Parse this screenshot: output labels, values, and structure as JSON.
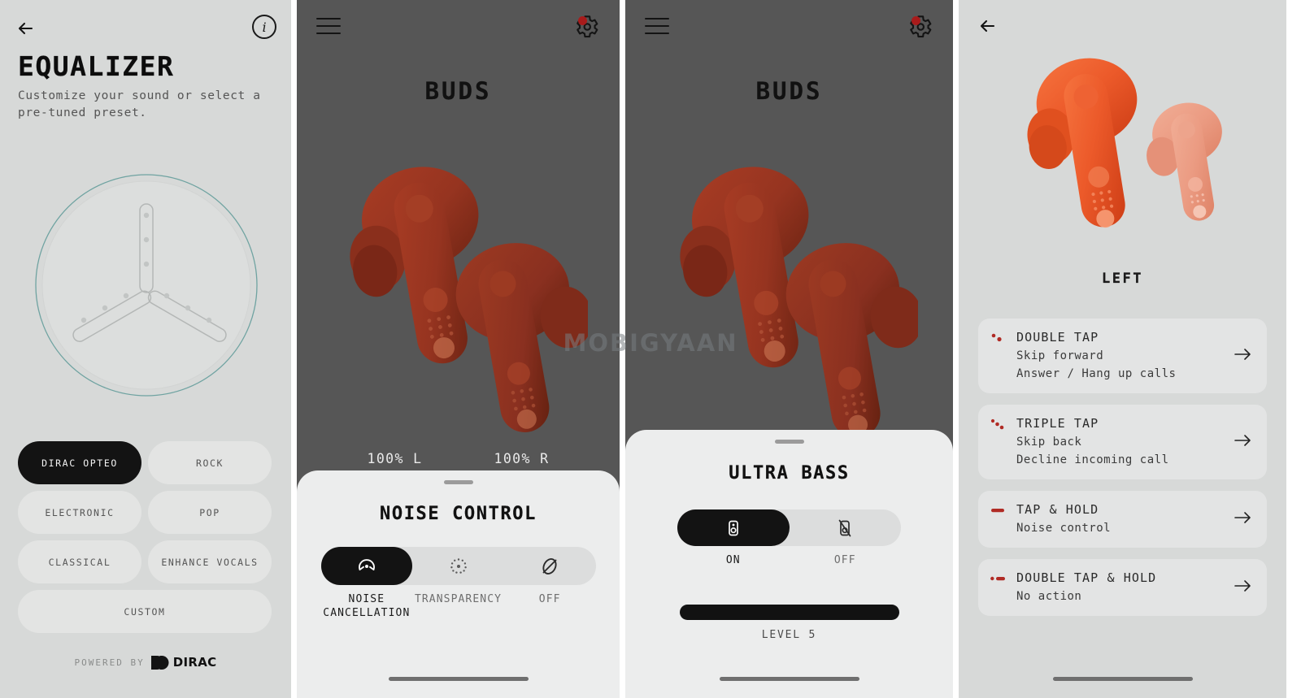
{
  "panel1": {
    "name": "equalizer-screen",
    "back_icon": "back-arrow-icon",
    "info_icon": "info-icon",
    "info_glyph": "i",
    "title": "EQUALIZER",
    "subtitle": "Customize your sound or select a pre-tuned preset.",
    "dial": {
      "name": "equalizer-dial",
      "arms": 3,
      "dots_per_arm": 3
    },
    "presets": [
      {
        "label": "DIRAC OPTEO",
        "active": true,
        "wide": false
      },
      {
        "label": "ROCK",
        "active": false,
        "wide": false
      },
      {
        "label": "ELECTRONIC",
        "active": false,
        "wide": false
      },
      {
        "label": "POP",
        "active": false,
        "wide": false
      },
      {
        "label": "CLASSICAL",
        "active": false,
        "wide": false
      },
      {
        "label": "ENHANCE VOCALS",
        "active": false,
        "wide": false
      },
      {
        "label": "CUSTOM",
        "active": false,
        "wide": true
      }
    ],
    "powered_by": "POWERED BY",
    "brand": "DIRAC"
  },
  "panel2": {
    "name": "buds-noise-control-screen",
    "menu_icon": "hamburger-menu-icon",
    "settings_icon": "gear-icon",
    "settings_badge": true,
    "title": "BUDS",
    "battery_left": "100% L",
    "battery_right": "100% R",
    "sheet_title": "NOISE CONTROL",
    "modes": [
      {
        "label": "NOISE CANCELLATION",
        "icon": "noise-cancellation-icon",
        "selected": true
      },
      {
        "label": "TRANSPARENCY",
        "icon": "transparency-icon",
        "selected": false
      },
      {
        "label": "OFF",
        "icon": "noise-off-icon",
        "selected": false
      }
    ],
    "watermark": "MOBIGYAAN"
  },
  "panel3": {
    "name": "buds-ultra-bass-screen",
    "menu_icon": "hamburger-menu-icon",
    "settings_icon": "gear-icon",
    "settings_badge": true,
    "title": "BUDS",
    "sheet_title": "ULTRA BASS",
    "modes": [
      {
        "label": "ON",
        "icon": "speaker-icon",
        "selected": true
      },
      {
        "label": "OFF",
        "icon": "speaker-mute-icon",
        "selected": false
      }
    ],
    "slider": {
      "name": "bass-level-slider",
      "label": "LEVEL 5",
      "value": 5,
      "max": 5,
      "percent": 100
    }
  },
  "panel4": {
    "name": "gesture-controls-screen",
    "back_icon": "back-arrow-icon",
    "earbuds_image": "earbuds-left-right-image",
    "side_label": "LEFT",
    "gestures": [
      {
        "icon": "double-tap-icon",
        "title": "DOUBLE TAP",
        "lines": [
          "Skip forward",
          "Answer / Hang up calls"
        ],
        "chevron": "arrow-right-icon"
      },
      {
        "icon": "triple-tap-icon",
        "title": "TRIPLE TAP",
        "lines": [
          "Skip back",
          "Decline incoming call"
        ],
        "chevron": "arrow-right-icon"
      },
      {
        "icon": "tap-hold-icon",
        "title": "TAP & HOLD",
        "lines": [
          "Noise control"
        ],
        "chevron": "arrow-right-icon"
      },
      {
        "icon": "double-tap-hold-icon",
        "title": "DOUBLE TAP & HOLD",
        "lines": [
          "No action"
        ],
        "chevron": "arrow-right-icon"
      }
    ]
  },
  "colors": {
    "light_bg": "#d7d9d8",
    "dark_bg": "#565656",
    "sheet_bg": "#eceded",
    "accent_dark": "#131313",
    "badge_red": "#a81b1b",
    "gesture_red": "#b02a24",
    "earbud_orange": "#e8542a",
    "dial_teal": "#5f9a98"
  }
}
